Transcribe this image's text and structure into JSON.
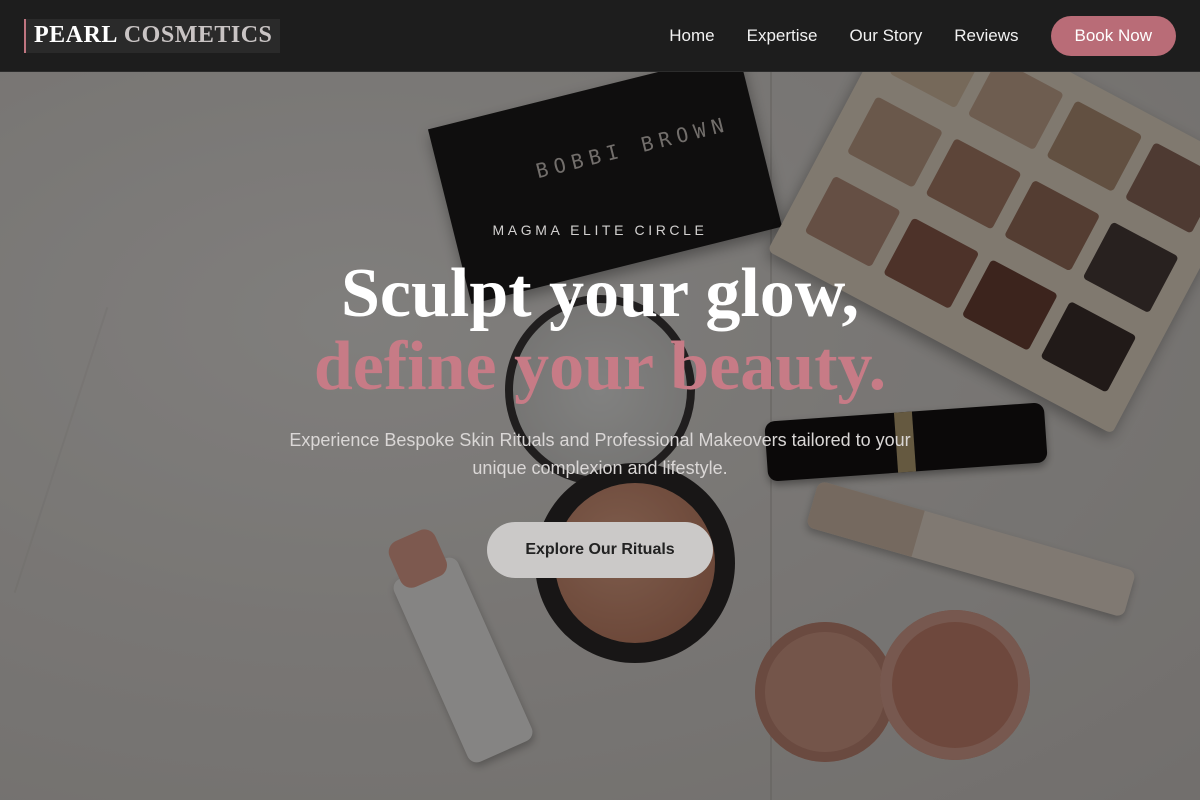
{
  "brand": {
    "name_part1": "PEARL",
    "name_part2": "COSMETICS"
  },
  "nav": {
    "links": [
      "Home",
      "Expertise",
      "Our Story",
      "Reviews"
    ],
    "cta": "Book Now"
  },
  "hero": {
    "eyebrow": "MAGMA ELITE CIRCLE",
    "headline_line1": "Sculpt your glow,",
    "headline_line2": "define your beauty.",
    "subtitle": "Experience Bespoke Skin Rituals and Professional Makeovers tailored to your unique complexion and lifestyle.",
    "cta": "Explore Our Rituals",
    "background_image_text": "BOBBI BROWN"
  },
  "colors": {
    "accent": "#c77b86",
    "button": "#b96c77",
    "navbar": "#1d1d1d"
  }
}
